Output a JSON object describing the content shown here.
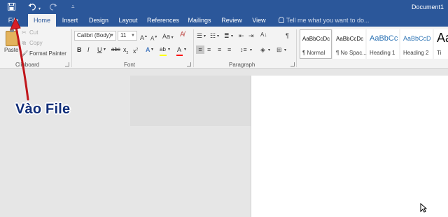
{
  "titlebar": {
    "document_title": "Document1",
    "save_icon": "save-icon",
    "undo_icon": "undo-icon",
    "redo_icon": "redo-icon",
    "customize_icon": "customize-qat-icon"
  },
  "tabs": [
    {
      "label": "File"
    },
    {
      "label": "Home",
      "active": true
    },
    {
      "label": "Insert"
    },
    {
      "label": "Design"
    },
    {
      "label": "Layout"
    },
    {
      "label": "References"
    },
    {
      "label": "Mailings"
    },
    {
      "label": "Review"
    },
    {
      "label": "View"
    }
  ],
  "tell_me": {
    "placeholder": "Tell me what you want to do..."
  },
  "clipboard": {
    "paste_label": "Paste",
    "cut_label": "Cut",
    "copy_label": "Copy",
    "format_painter_label": "Format Painter",
    "group_label": "Clipboard"
  },
  "font": {
    "font_name": "Calibri (Body)",
    "font_size": "11",
    "grow_label": "A",
    "shrink_label": "A",
    "case_label": "Aa",
    "bold": "B",
    "italic": "I",
    "underline": "U",
    "strike": "abc",
    "subscript": "x",
    "superscript": "x",
    "text_effects": "A",
    "highlight": "ab",
    "font_color": "A",
    "group_label": "Font",
    "highlight_color": "#ffff00",
    "font_color_value": "#ff0000"
  },
  "paragraph": {
    "group_label": "Paragraph",
    "pilcrow": "¶"
  },
  "styles": [
    {
      "sample": "AaBbCcDc",
      "name": "¶ Normal",
      "selected": true
    },
    {
      "sample": "AaBbCcDc",
      "name": "¶ No Spac..."
    },
    {
      "sample": "AaBbCc",
      "name": "Heading 1"
    },
    {
      "sample": "AaBbCcD",
      "name": "Heading 2"
    },
    {
      "sample": "AaB",
      "name": "Ti"
    }
  ],
  "annotation": {
    "text": "Vào File",
    "arrow_color": "#e31e24"
  },
  "colors": {
    "accent": "#2b579a",
    "annotation_text": "#102d78"
  }
}
